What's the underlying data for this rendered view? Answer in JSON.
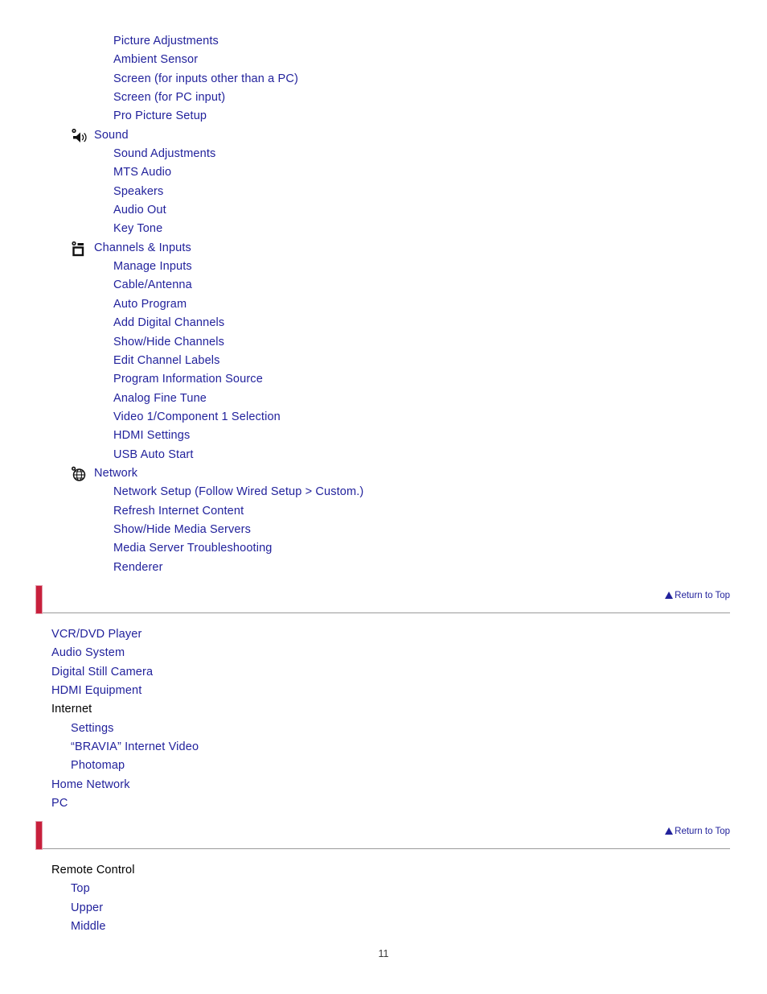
{
  "colors": {
    "link": "#22229c",
    "text": "#000000",
    "red_bar": "#c8203c",
    "rule": "#9a9a9a"
  },
  "page_number": "11",
  "return_to_top": {
    "label": "Return to Top",
    "icon": "triangle-up-icon"
  },
  "sections": [
    {
      "name": "settings-toc",
      "rows": [
        {
          "label": "Picture Adjustments",
          "level": "sub",
          "link": true
        },
        {
          "label": "Ambient Sensor",
          "level": "sub",
          "link": true
        },
        {
          "label": "Screen (for inputs other than a PC)",
          "level": "sub",
          "link": true
        },
        {
          "label": "Screen (for PC input)",
          "level": "sub",
          "link": true
        },
        {
          "label": "Pro Picture Setup",
          "level": "sub",
          "link": true
        },
        {
          "label": "Sound",
          "level": "category",
          "link": true,
          "icon": "speaker-icon"
        },
        {
          "label": "Sound Adjustments",
          "level": "sub",
          "link": true
        },
        {
          "label": "MTS Audio",
          "level": "sub",
          "link": true
        },
        {
          "label": "Speakers",
          "level": "sub",
          "link": true
        },
        {
          "label": "Audio Out",
          "level": "sub",
          "link": true
        },
        {
          "label": "Key Tone",
          "level": "sub",
          "link": true
        },
        {
          "label": "Channels & Inputs",
          "level": "category",
          "link": true,
          "icon": "input-box-icon"
        },
        {
          "label": "Manage Inputs",
          "level": "sub",
          "link": true
        },
        {
          "label": "Cable/Antenna",
          "level": "sub",
          "link": true
        },
        {
          "label": "Auto Program",
          "level": "sub",
          "link": true
        },
        {
          "label": "Add Digital Channels",
          "level": "sub",
          "link": true
        },
        {
          "label": "Show/Hide Channels",
          "level": "sub",
          "link": true
        },
        {
          "label": "Edit Channel Labels",
          "level": "sub",
          "link": true
        },
        {
          "label": "Program Information Source",
          "level": "sub",
          "link": true
        },
        {
          "label": "Analog Fine Tune",
          "level": "sub",
          "link": true
        },
        {
          "label": "Video 1/Component 1 Selection",
          "level": "sub",
          "link": true
        },
        {
          "label": "HDMI Settings",
          "level": "sub",
          "link": true
        },
        {
          "label": "USB Auto Start",
          "level": "sub",
          "link": true
        },
        {
          "label": "Network",
          "level": "category",
          "link": true,
          "icon": "globe-icon"
        },
        {
          "label": "Network Setup (Follow Wired Setup > Custom.)",
          "level": "sub",
          "link": true
        },
        {
          "label": "Refresh Internet Content",
          "level": "sub",
          "link": true
        },
        {
          "label": "Show/Hide Media Servers",
          "level": "sub",
          "link": true
        },
        {
          "label": "Media Server Troubleshooting",
          "level": "sub",
          "link": true
        },
        {
          "label": "Renderer",
          "level": "sub",
          "link": true
        }
      ]
    },
    {
      "name": "devices-toc",
      "rows": [
        {
          "label": "VCR/DVD Player",
          "level": "a",
          "link": true
        },
        {
          "label": "Audio System",
          "level": "a",
          "link": true
        },
        {
          "label": "Digital Still Camera",
          "level": "a",
          "link": true
        },
        {
          "label": "HDMI Equipment",
          "level": "a",
          "link": true
        },
        {
          "label": "Internet",
          "level": "a",
          "link": false
        },
        {
          "label": "Settings",
          "level": "b",
          "link": true
        },
        {
          "label": "“BRAVIA” Internet Video",
          "level": "b",
          "link": true
        },
        {
          "label": "Photomap",
          "level": "b",
          "link": true
        },
        {
          "label": "Home Network",
          "level": "a",
          "link": true
        },
        {
          "label": "PC",
          "level": "a",
          "link": true
        }
      ]
    },
    {
      "name": "parts-toc",
      "rows": [
        {
          "label": "Remote Control",
          "level": "a",
          "link": false
        },
        {
          "label": "Top",
          "level": "b",
          "link": true
        },
        {
          "label": "Upper",
          "level": "b",
          "link": true
        },
        {
          "label": "Middle",
          "level": "b",
          "link": true
        }
      ]
    }
  ]
}
